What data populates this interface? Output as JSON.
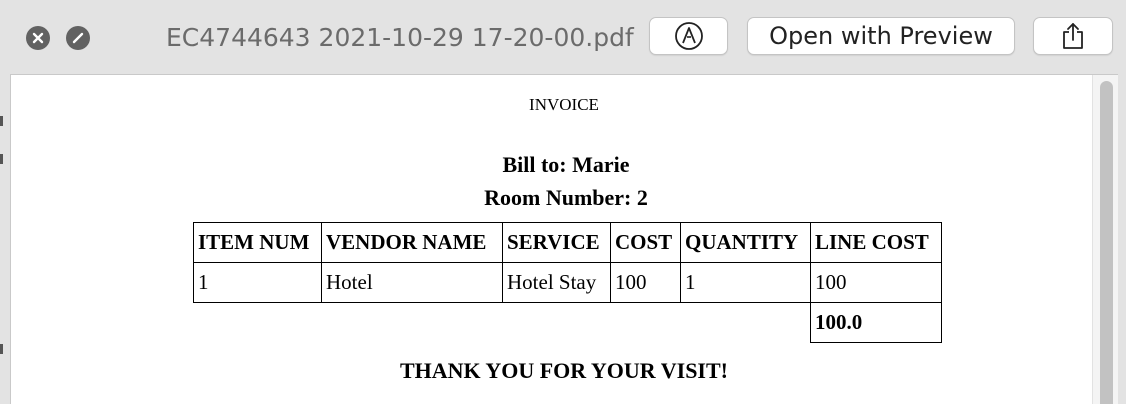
{
  "window": {
    "filename": "EC4744643 2021-10-29 17-20-00.pdf",
    "open_with_label": "Open with Preview",
    "markup_icon": "markup-pen-icon",
    "share_icon": "share-icon",
    "close_icon": "close-icon",
    "minimize_icon": "fullscreen-toggle-icon"
  },
  "invoice": {
    "title": "INVOICE",
    "bill_to": "Bill to: Marie",
    "room_number": "Room Number: 2",
    "headers": [
      "ITEM NUM",
      "VENDOR NAME",
      "SERVICE",
      "COST",
      "QUANTITY",
      "LINE COST"
    ],
    "rows": [
      [
        "1",
        "Hotel",
        "Hotel Stay",
        "100",
        "1",
        "100"
      ]
    ],
    "total": "100.0",
    "thank_you": "THANK YOU FOR YOUR VISIT!"
  },
  "colors": {
    "titlebar_bg": "#e3e3e3",
    "control_gray": "#626262",
    "filename_text": "#6b6b6b",
    "page_bg": "#ffffff"
  }
}
